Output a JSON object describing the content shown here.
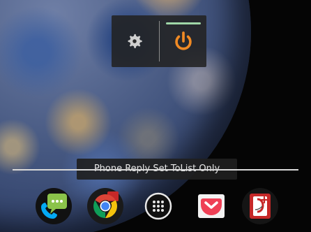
{
  "home_screen": {
    "quick_settings": {
      "settings_icon": "gear-icon",
      "power_icon": "power-icon",
      "indicator_color": "#9fd6a7",
      "power_color": "#f08a24"
    },
    "tooltip": {
      "text": "Phone Reply Set ToList Only"
    },
    "dock": {
      "items": [
        {
          "icon": "phone-message-icon"
        },
        {
          "icon": "chrome-icon"
        },
        {
          "icon": "app-drawer-icon"
        },
        {
          "icon": "pocket-icon"
        },
        {
          "icon": "google-plus-icon"
        }
      ]
    }
  }
}
